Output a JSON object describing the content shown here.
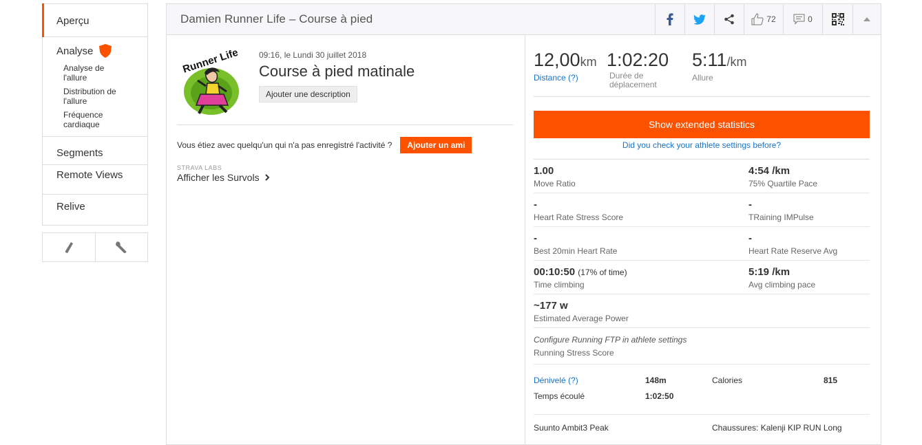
{
  "sidebar": {
    "items": [
      {
        "label": "Aperçu"
      },
      {
        "label": "Analyse"
      },
      {
        "label": "Segments"
      },
      {
        "label": "Remote Views"
      },
      {
        "label": "Relive"
      }
    ],
    "analyse_sub": [
      "Analyse de l'allure",
      "Distribution de l'allure",
      "Fréquence cardiaque"
    ],
    "tools": [
      "pencil-icon",
      "wrench-icon"
    ]
  },
  "header": {
    "title": "Damien Runner Life – Course à pied",
    "kudos_count": "72",
    "comment_count": "0"
  },
  "activity": {
    "when": "09:16, le Lundi 30 juillet 2018",
    "name": "Course à pied matinale",
    "add_description": "Ajouter une description",
    "friend_question": "Vous étiez avec quelqu'un qui n'a pas enregistré l'activité ?",
    "add_friend": "Ajouter un ami",
    "labs_tag": "STRAVA LABS",
    "labs_link": "Afficher les Survols",
    "avatar_text": "Runner Life"
  },
  "summary": {
    "distance": {
      "value": "12,00",
      "unit": "km",
      "label": "Distance (?)"
    },
    "moving_time": {
      "value": "1:02:20",
      "label": "Durée de déplacement"
    },
    "pace": {
      "value": "5:11",
      "unit": "/km",
      "label": "Allure"
    }
  },
  "extended": {
    "button": "Show extended statistics",
    "athlete_link": "Did you check your athlete settings before?",
    "rows": [
      [
        {
          "value": "1.00",
          "label": "Move Ratio"
        },
        {
          "value": "4:54 /km",
          "label": "75% Quartile Pace"
        }
      ],
      [
        {
          "value": "-",
          "label": "Heart Rate Stress Score"
        },
        {
          "value": "-",
          "label": "TRaining IMPulse"
        }
      ],
      [
        {
          "value": "-",
          "label": "Best 20min Heart Rate"
        },
        {
          "value": "-",
          "label": "Heart Rate Reserve Avg"
        }
      ],
      [
        {
          "value": "00:10:50",
          "extra": "(17% of time)",
          "label": "Time climbing"
        },
        {
          "value": "5:19 /km",
          "label": "Avg climbing pace"
        }
      ],
      [
        {
          "value": "~177 w",
          "label": "Estimated Average Power"
        }
      ]
    ],
    "ftp_note": "Configure Running FTP in athlete settings",
    "ftp_label": "Running Stress Score"
  },
  "misc": {
    "elevation_label": "Dénivelé (?)",
    "elevation_value": "148m",
    "calories_label": "Calories",
    "calories_value": "815",
    "elapsed_label": "Temps écoulé",
    "elapsed_value": "1:02:50"
  },
  "device": {
    "name": "Suunto Ambit3 Peak",
    "shoes": "Chaussures: Kalenji KIP RUN Long"
  },
  "colors": {
    "accent": "#fc5200",
    "link": "#1a73c9",
    "facebook": "#3b5998",
    "twitter": "#1da1f2"
  }
}
